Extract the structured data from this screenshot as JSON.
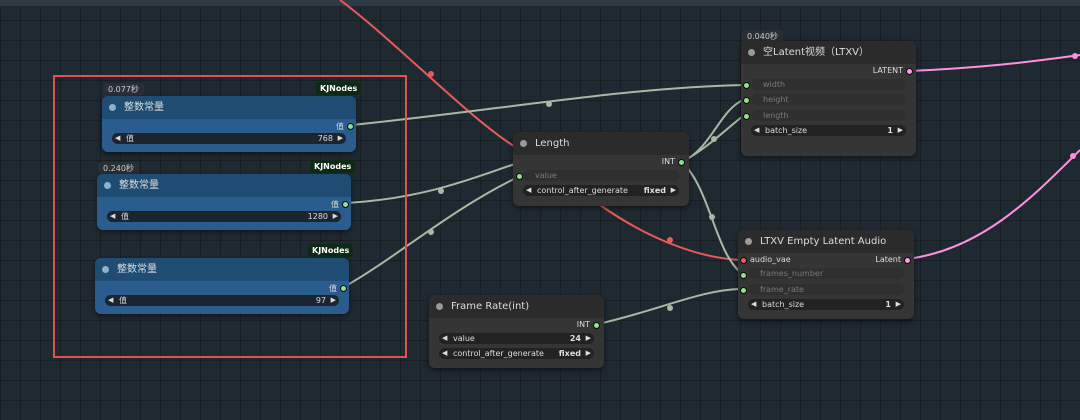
{
  "selection_color": "#e25050",
  "nodes": {
    "int1": {
      "time": "0.077秒",
      "tag": "KJNodes",
      "title": "整数常量",
      "out_label": "值",
      "widget_label": "值",
      "widget_value": "768"
    },
    "int2": {
      "time": "0.240秒",
      "tag": "KJNodes",
      "title": "整数常量",
      "out_label": "值",
      "widget_label": "值",
      "widget_value": "1280"
    },
    "int3": {
      "tag": "KJNodes",
      "title": "整数常量",
      "out_label": "值",
      "widget_label": "值",
      "widget_value": "97"
    },
    "length": {
      "title": "Length",
      "out_label": "INT",
      "input_value": "value",
      "combo_label": "control_after_generate",
      "combo_value": "fixed"
    },
    "frame_rate": {
      "title": "Frame Rate(int)",
      "out_label": "INT",
      "value_label": "value",
      "value": "24",
      "combo_label": "control_after_generate",
      "combo_value": "fixed"
    },
    "latent_video": {
      "time": "0.040秒",
      "title": "空Latent视频（LTXV）",
      "out_label": "LATENT",
      "inputs": [
        "width",
        "height",
        "length"
      ],
      "batch_label": "batch_size",
      "batch_value": "1"
    },
    "latent_audio": {
      "title": "LTXV Empty Latent Audio",
      "in_label": "audio_vae",
      "out_label": "Latent",
      "inputs": [
        "frames_number",
        "frame_rate"
      ],
      "batch_label": "batch_size",
      "batch_value": "1"
    }
  }
}
